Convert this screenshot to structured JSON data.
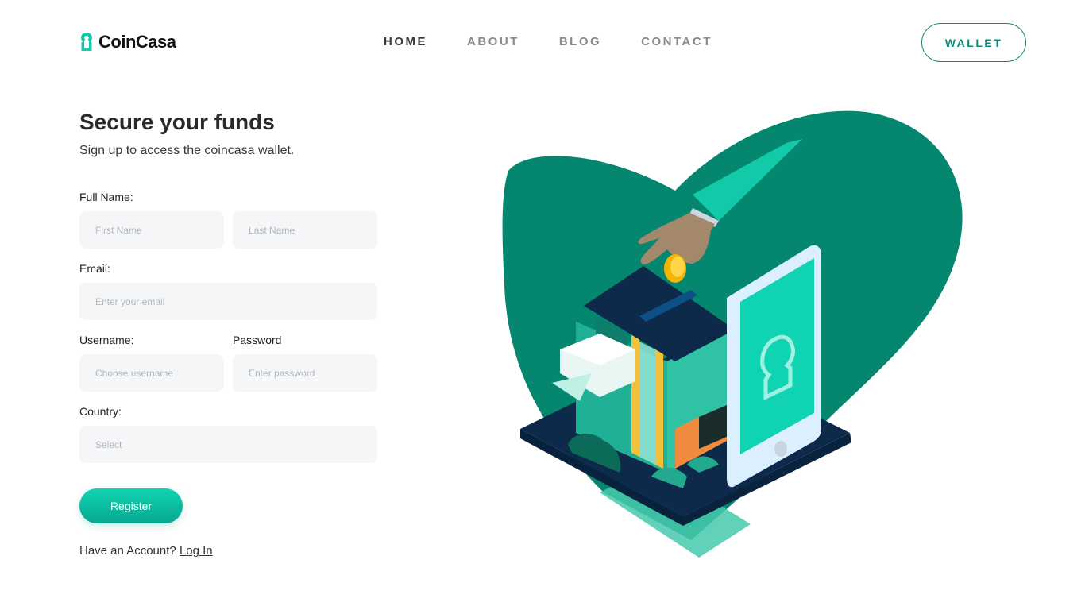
{
  "brand": {
    "name": "CoinCasa",
    "accent": "#0e8a78",
    "accent_light": "#12d3b3"
  },
  "nav": {
    "items": [
      {
        "label": "HOME",
        "active": true
      },
      {
        "label": "ABOUT",
        "active": false
      },
      {
        "label": "BLOG",
        "active": false
      },
      {
        "label": "CONTACT",
        "active": false
      }
    ],
    "wallet_label": "WALLET"
  },
  "form": {
    "title": "Secure your funds",
    "subtitle": "Sign up to access the coincasa wallet.",
    "full_name_label": "Full Name:",
    "first_name_placeholder": "First Name",
    "last_name_placeholder": "Last Name",
    "email_label": "Email:",
    "email_placeholder": "Enter your email",
    "username_label": "Username:",
    "username_placeholder": "Choose username",
    "password_label": "Password",
    "password_placeholder": "Enter password",
    "country_label": "Country:",
    "country_value": "Select",
    "register_label": "Register",
    "account_prompt": "Have an Account?",
    "login_label": "Log In"
  }
}
